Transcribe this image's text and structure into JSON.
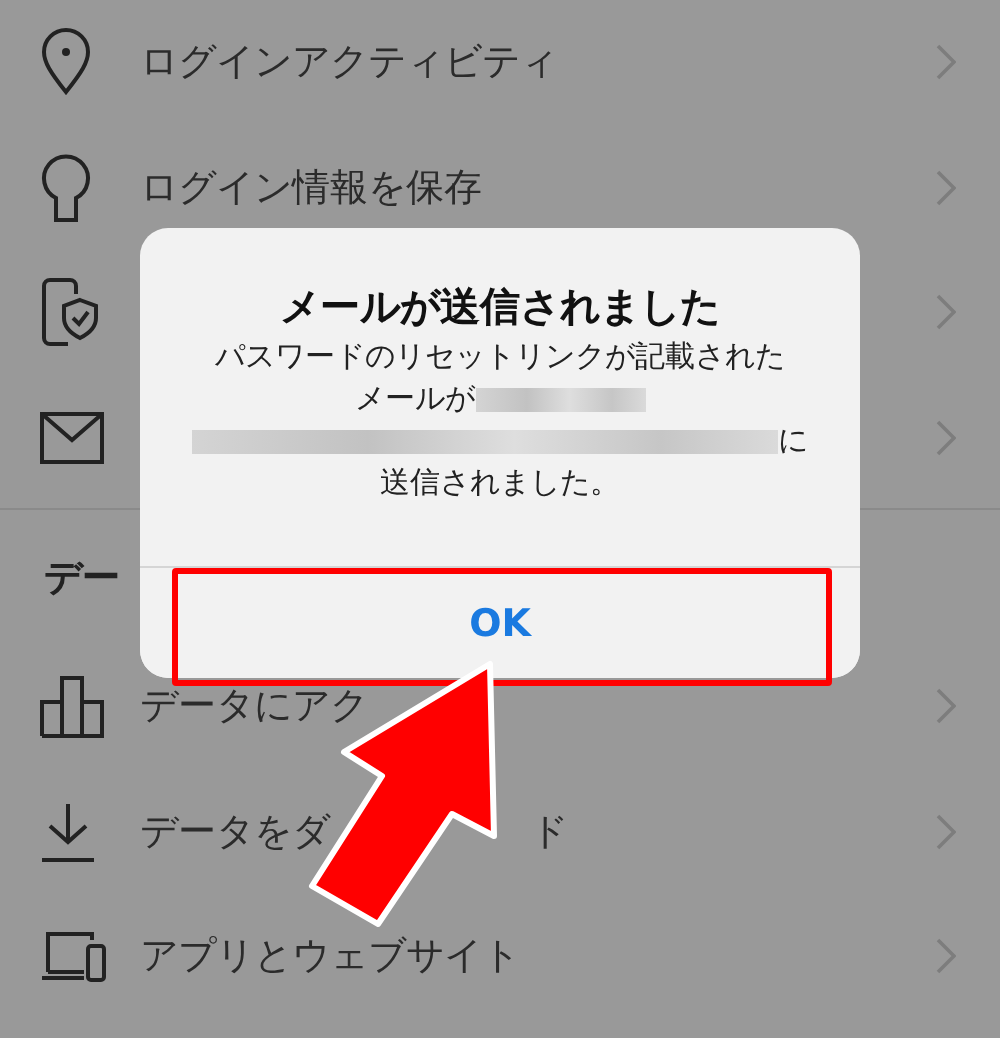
{
  "security_rows": [
    {
      "label": "ログインアクティビティ"
    },
    {
      "label": "ログイン情報を保存"
    },
    {
      "label": null
    },
    {
      "label": null
    }
  ],
  "data_section": {
    "header": "デー",
    "rows": [
      {
        "label": "データにアク"
      },
      {
        "label": "データをダ",
        "label_end": "ド"
      },
      {
        "label": "アプリとウェブサイト"
      }
    ]
  },
  "alert": {
    "title": "メールが送信されました",
    "message_lines": [
      [
        {
          "kind": "text",
          "text": "パスワードのリセットリンクが記載された"
        }
      ],
      [
        {
          "kind": "text",
          "text": "メールが"
        },
        {
          "kind": "redacted"
        }
      ],
      [
        {
          "kind": "redacted"
        },
        {
          "kind": "text",
          "text": "に"
        }
      ],
      [
        {
          "kind": "text",
          "text": "送信されました。"
        }
      ]
    ],
    "button": "OK"
  },
  "annotation": {
    "highlight": true,
    "arrow": true
  }
}
